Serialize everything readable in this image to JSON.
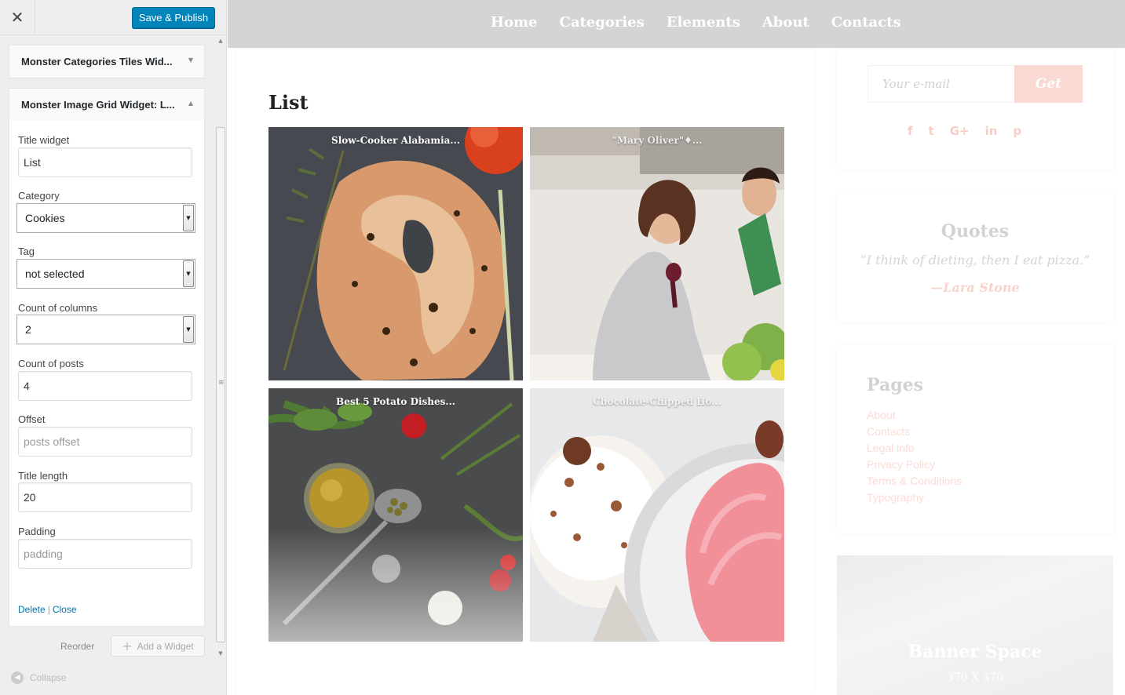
{
  "customizer": {
    "close_icon": "close-icon",
    "publish_label": "Save & Publish",
    "accent": "#0085ba",
    "widgets": [
      {
        "title": "Monster Categories Tiles Wid...",
        "expanded": false
      },
      {
        "title": "Monster Image Grid Widget: L...",
        "expanded": true
      }
    ],
    "form": {
      "title_widget": {
        "label": "Title widget",
        "value": "List"
      },
      "category": {
        "label": "Category",
        "value": "Cookies"
      },
      "tag": {
        "label": "Tag",
        "value": "not selected"
      },
      "columns": {
        "label": "Count of columns",
        "value": "2"
      },
      "posts": {
        "label": "Count of posts",
        "value": "4"
      },
      "offset": {
        "label": "Offset",
        "placeholder": "posts offset"
      },
      "title_length": {
        "label": "Title length",
        "value": "20"
      },
      "padding": {
        "label": "Padding",
        "placeholder": "padding"
      }
    },
    "actions": {
      "delete": "Delete",
      "separator": "|",
      "close": "Close"
    },
    "reorder": "Reorder",
    "add_widget": "Add a Widget",
    "collapse": "Collapse"
  },
  "preview": {
    "nav": [
      "Home",
      "Categories",
      "Elements",
      "About",
      "Contacts"
    ],
    "list_title": "List",
    "tiles": [
      {
        "caption": "Slow-Cooker Alabamia...",
        "image": "grilled-salmon-steak"
      },
      {
        "caption": "\"Mary Oliver\"♦...",
        "image": "couple-in-kitchen"
      },
      {
        "caption": "Best 5 Potato Dishes...",
        "image": "herbs-oil-spices"
      },
      {
        "caption": "Chocolate-Chipped Ho...",
        "image": "cupcakes"
      }
    ],
    "subscribe": {
      "placeholder": "Your e-mail",
      "button": "Get"
    },
    "socials": [
      "f",
      "t",
      "G+",
      "in",
      "p"
    ],
    "quotes": {
      "title": "Quotes",
      "text": "“I think of dieting, then I eat pizza.”",
      "author": "—Lara Stone"
    },
    "pages": {
      "title": "Pages",
      "items": [
        "About",
        "Contacts",
        "Legal info",
        "Privacy Policy",
        "Terms & Conditions",
        "Typography"
      ]
    },
    "banner": {
      "title": "Banner Space",
      "size": "370 X 370"
    }
  }
}
